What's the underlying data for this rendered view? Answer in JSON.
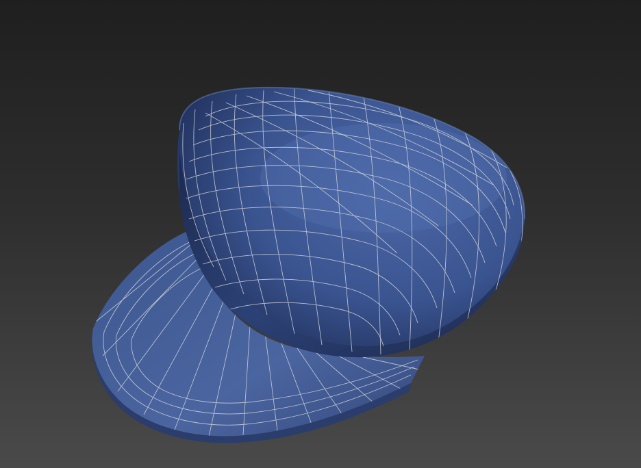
{
  "viewport": {
    "background_top": "#1f1f1f",
    "background_bottom": "#4a4a4a"
  },
  "model": {
    "object": "flat-cap-mesh",
    "material_color": "#3b5590",
    "shadow_color": "#16213d",
    "wireframe_color": "#cfd4dc"
  }
}
